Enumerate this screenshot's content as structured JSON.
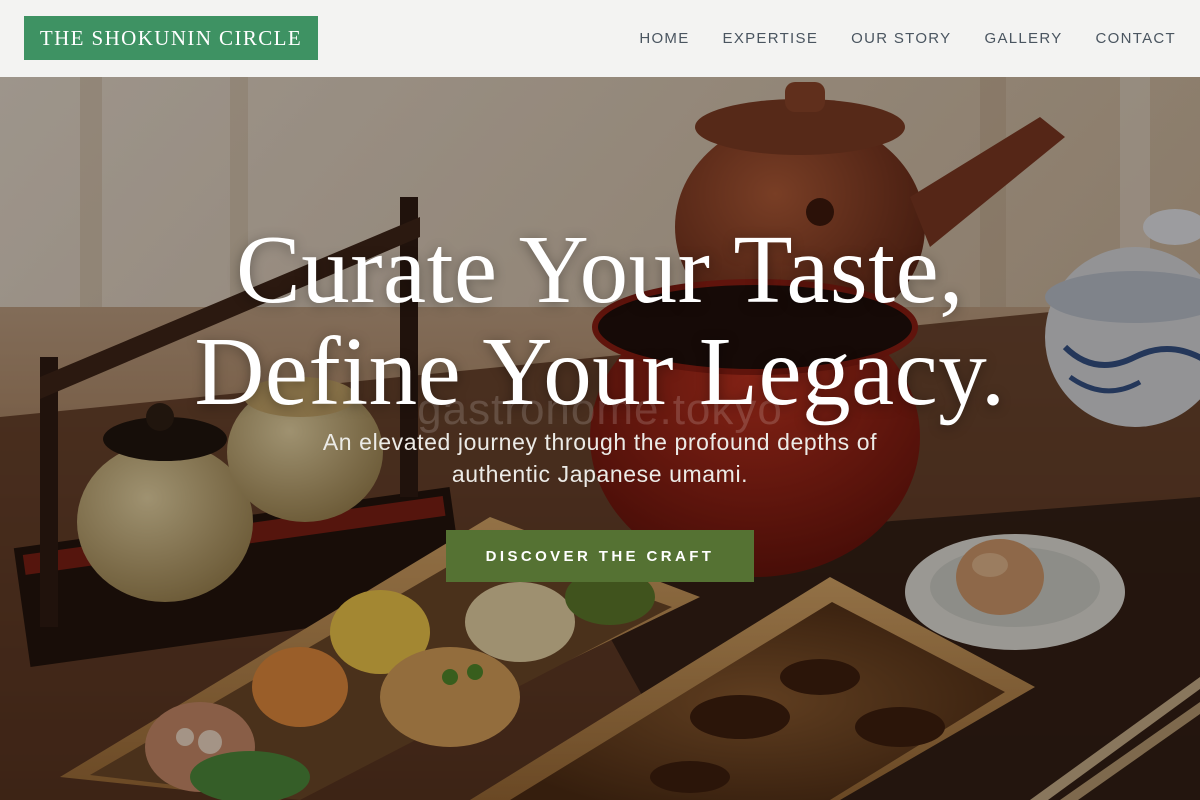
{
  "brand": {
    "logo_text": "THE SHOKUNIN CIRCLE",
    "color": "#3e9263"
  },
  "nav": {
    "items": [
      {
        "label": "HOME"
      },
      {
        "label": "EXPERTISE"
      },
      {
        "label": "OUR STORY"
      },
      {
        "label": "GALLERY"
      },
      {
        "label": "CONTACT"
      }
    ]
  },
  "hero": {
    "title_line1": "Curate Your Taste,",
    "title_line2": "Define Your Legacy.",
    "watermark": "gastronome.tokyo",
    "subtitle_line1": "An elevated journey through the profound depths of",
    "subtitle_line2": "authentic Japanese umami.",
    "cta_label": "DISCOVER THE CRAFT",
    "cta_color": "#557233",
    "background_image": "Japanese bento boxes with teapot, soup bowl and condiment jars on a wooden table"
  }
}
